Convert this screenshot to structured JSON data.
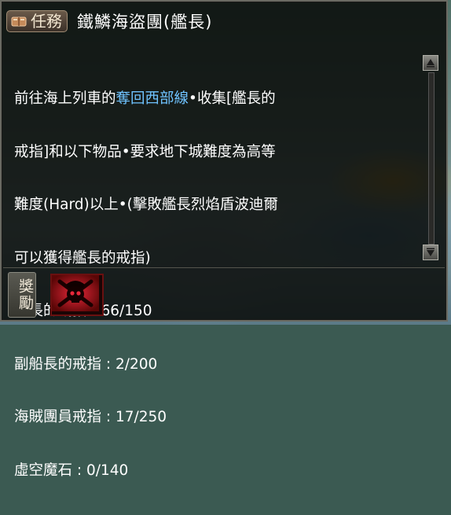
{
  "header": {
    "badge_label": "任務",
    "badge_icon": "book-icon",
    "title": "鐵鱗海盜團(艦長)"
  },
  "description": {
    "part1": "前往海上列車的",
    "location": "奪回西部線",
    "part2": "•收集[艦長的",
    "line2": "戒指]和以下物品•要求地下城難度為高等",
    "line3": "難度(Hard)以上•(擊敗艦長烈焰盾波迪爾",
    "line4": "可以獲得艦長的戒指)"
  },
  "requirements": [
    {
      "label": "艦長的戒指 : 66/150"
    },
    {
      "label": "副船長的戒指 : 2/200"
    },
    {
      "label": "海賊團員戒指 : 17/250"
    },
    {
      "label": "虛空魔石 : 0/140"
    }
  ],
  "reward": {
    "label": "獎勵",
    "item_icon": "pirate-skull-icon"
  },
  "colors": {
    "highlight": "#6fc3ff",
    "text": "#ffffff"
  }
}
